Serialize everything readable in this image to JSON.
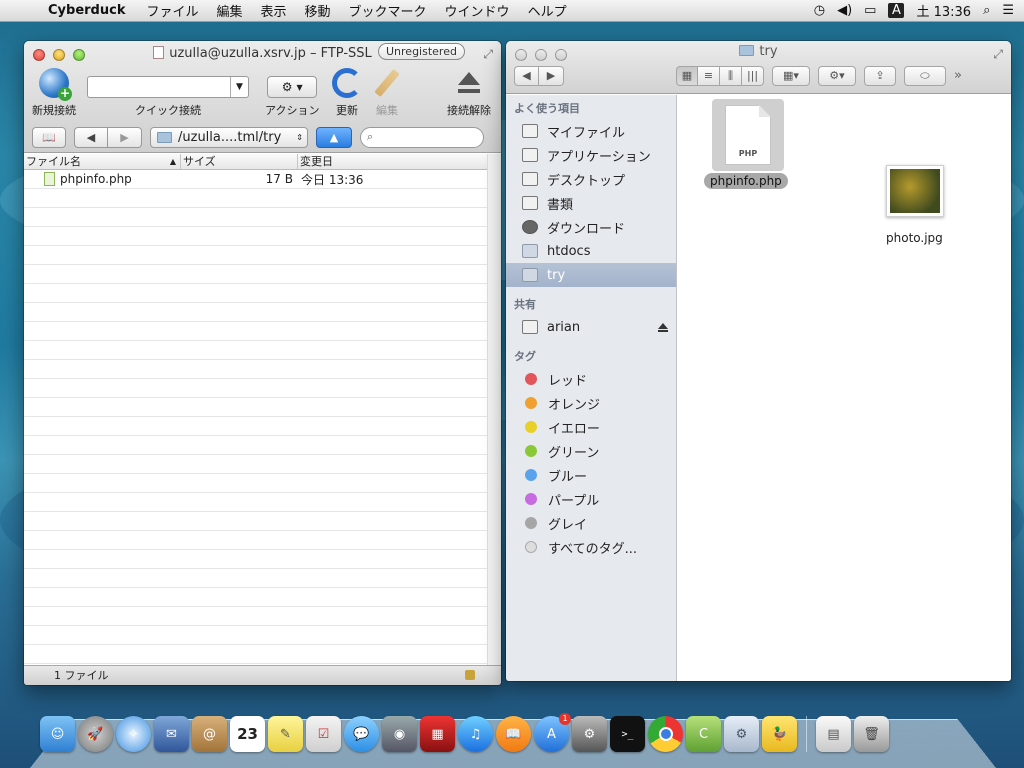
{
  "menubar": {
    "app_name": "Cyberduck",
    "items": [
      "ファイル",
      "編集",
      "表示",
      "移動",
      "ブックマーク",
      "ウインドウ",
      "ヘルプ"
    ],
    "clock": "土 13:36",
    "ime_label": "A"
  },
  "cyberduck": {
    "title": "uzulla@uzulla.xsrv.jp – FTP-SSL",
    "badge": "Unregistered",
    "toolbar": {
      "new_connection": "新規接続",
      "quick_connect": "クイック接続",
      "action": "アクション",
      "refresh": "更新",
      "edit": "編集",
      "disconnect": "接続解除"
    },
    "path": "/uzulla....tml/try",
    "columns": {
      "name": "ファイル名",
      "size": "サイズ",
      "modified": "変更日"
    },
    "files": [
      {
        "name": "phpinfo.php",
        "size": "17 B",
        "modified": "今日 13:36"
      }
    ],
    "status": "1 ファイル"
  },
  "finder": {
    "title": "try",
    "sidebar": {
      "favorites_header": "よく使う項目",
      "favorites": [
        "マイファイル",
        "アプリケーション",
        "デスクトップ",
        "書類",
        "ダウンロード",
        "htdocs",
        "try"
      ],
      "shared_header": "共有",
      "shared": [
        "arian"
      ],
      "tags_header": "タグ",
      "tags": [
        {
          "label": "レッド",
          "color": "#e2555a"
        },
        {
          "label": "オレンジ",
          "color": "#f0a030"
        },
        {
          "label": "イエロー",
          "color": "#e8d028"
        },
        {
          "label": "グリーン",
          "color": "#8ac838"
        },
        {
          "label": "ブルー",
          "color": "#5aa2ec"
        },
        {
          "label": "パープル",
          "color": "#c66ce0"
        },
        {
          "label": "グレイ",
          "color": "#a6a6a6"
        }
      ],
      "all_tags": "すべてのタグ..."
    },
    "files": [
      {
        "name": "phpinfo.php",
        "badge": "PHP"
      },
      {
        "name": "photo.jpg"
      }
    ]
  },
  "dock": {
    "calendar_day": "23",
    "appstore_badge": "1"
  }
}
